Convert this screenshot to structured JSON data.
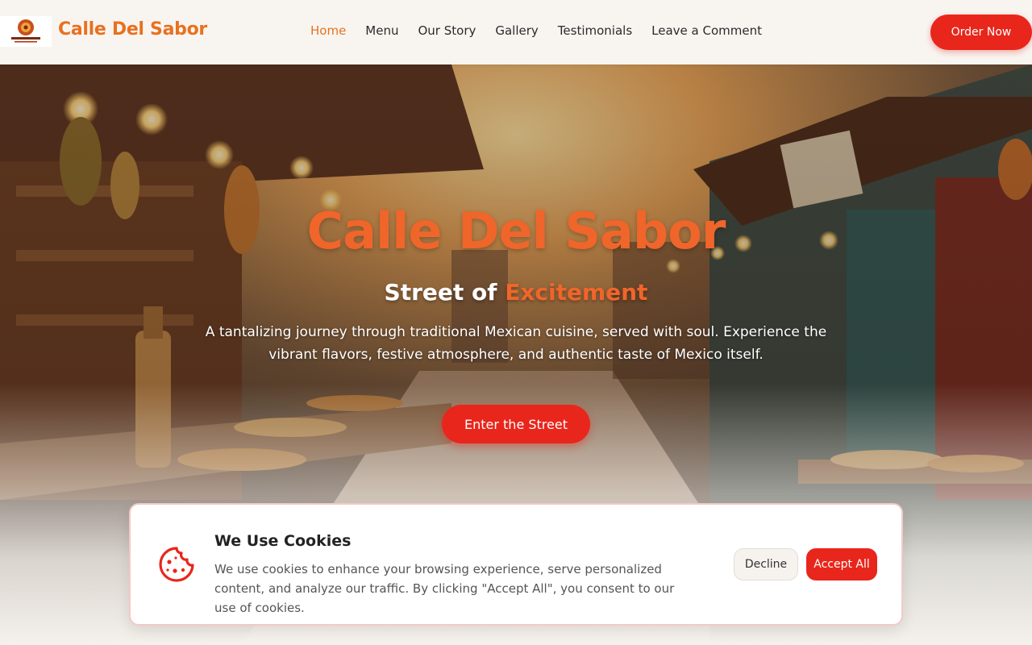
{
  "colors": {
    "brand_orange": "#e8711f",
    "accent_red": "#e8261b",
    "title_orange": "#f0652a",
    "nav_bg": "#f8f5f1"
  },
  "nav": {
    "logo_alt": "Calle Del Sabor logo",
    "brand": "Calle Del Sabor",
    "links": [
      {
        "label": "Home",
        "active": true
      },
      {
        "label": "Menu",
        "active": false
      },
      {
        "label": "Our Story",
        "active": false
      },
      {
        "label": "Gallery",
        "active": false
      },
      {
        "label": "Testimonials",
        "active": false
      },
      {
        "label": "Leave a Comment",
        "active": false
      }
    ],
    "order_button": "Order Now"
  },
  "hero": {
    "title": "Calle Del Sabor",
    "subtitle_plain": "Street of ",
    "subtitle_accent": "Excitement",
    "description": "A tantalizing journey through traditional Mexican cuisine, served with soul. Experience the vibrant flavors, festive atmosphere, and authentic taste of Mexico itself.",
    "cta_button": "Enter the Street"
  },
  "cookie_banner": {
    "icon": "cookie-icon",
    "title": "We Use Cookies",
    "text": "We use cookies to enhance your browsing experience, serve personalized content, and analyze our traffic. By clicking \"Accept All\", you consent to our use of cookies.",
    "decline_button": "Decline",
    "accept_button": "Accept All"
  }
}
